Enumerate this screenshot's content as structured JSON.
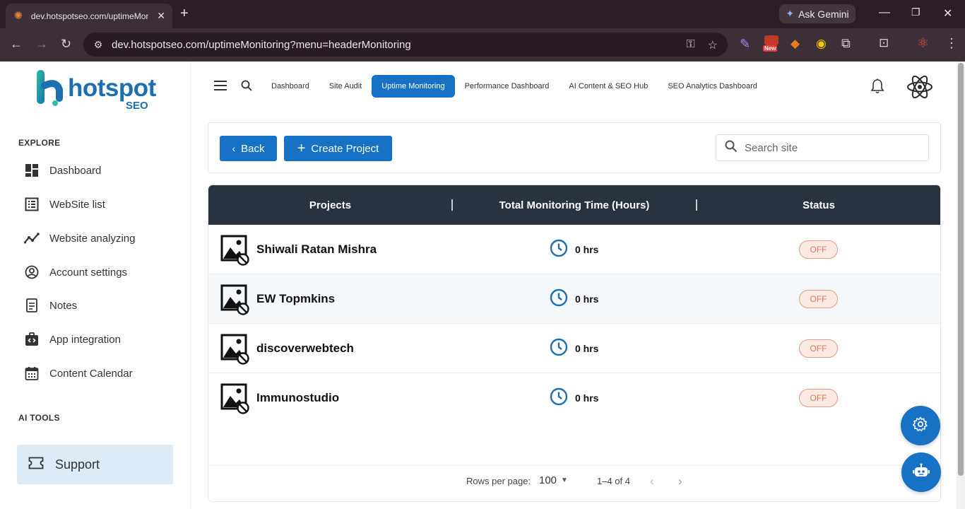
{
  "browser": {
    "tab_title": "dev.hotspotseo.com/uptimeMonitoring",
    "url": "dev.hotspotseo.com/uptimeMonitoring?menu=headerMonitoring",
    "gemini_label": "Ask Gemini",
    "new_badge": "New"
  },
  "logo": {
    "text": "hotspot",
    "sub": "SEO"
  },
  "sidebar": {
    "explore_title": "EXPLORE",
    "items": [
      {
        "label": "Dashboard",
        "icon": "dashboard-icon"
      },
      {
        "label": "WebSite list",
        "icon": "list-icon"
      },
      {
        "label": "Website analyzing",
        "icon": "trend-icon"
      },
      {
        "label": "Account settings",
        "icon": "account-icon"
      },
      {
        "label": "Notes",
        "icon": "notes-icon"
      },
      {
        "label": "App integration",
        "icon": "integration-icon"
      },
      {
        "label": "Content Calendar",
        "icon": "calendar-icon"
      }
    ],
    "ai_title": "AI TOOLS",
    "support_label": "Support"
  },
  "topnav": {
    "items": [
      "Dashboard",
      "Site Audit",
      "Uptime Monitoring",
      "Performance Dashboard",
      "AI Content & SEO Hub",
      "SEO Analytics Dashboard"
    ],
    "active": "Uptime Monitoring"
  },
  "toolbar": {
    "back_label": "Back",
    "create_label": "Create Project",
    "search_placeholder": "Search site"
  },
  "table": {
    "headers": [
      "Projects",
      "Total Monitoring Time (Hours)",
      "Status"
    ],
    "rows": [
      {
        "name": "Shiwali Ratan Mishra",
        "time": "0 hrs",
        "status": "OFF"
      },
      {
        "name": "EW Topmkins",
        "time": "0 hrs",
        "status": "OFF"
      },
      {
        "name": "discoverwebtech",
        "time": "0 hrs",
        "status": "OFF"
      },
      {
        "name": "Immunostudio",
        "time": "0 hrs",
        "status": "OFF"
      }
    ],
    "pagination": {
      "rows_per_page_label": "Rows per page:",
      "rows_per_page": "100",
      "range": "1–4 of 4"
    }
  },
  "colors": {
    "primary": "#1771c4",
    "header_dark": "#29323f",
    "status_off": "#e07a5f"
  }
}
